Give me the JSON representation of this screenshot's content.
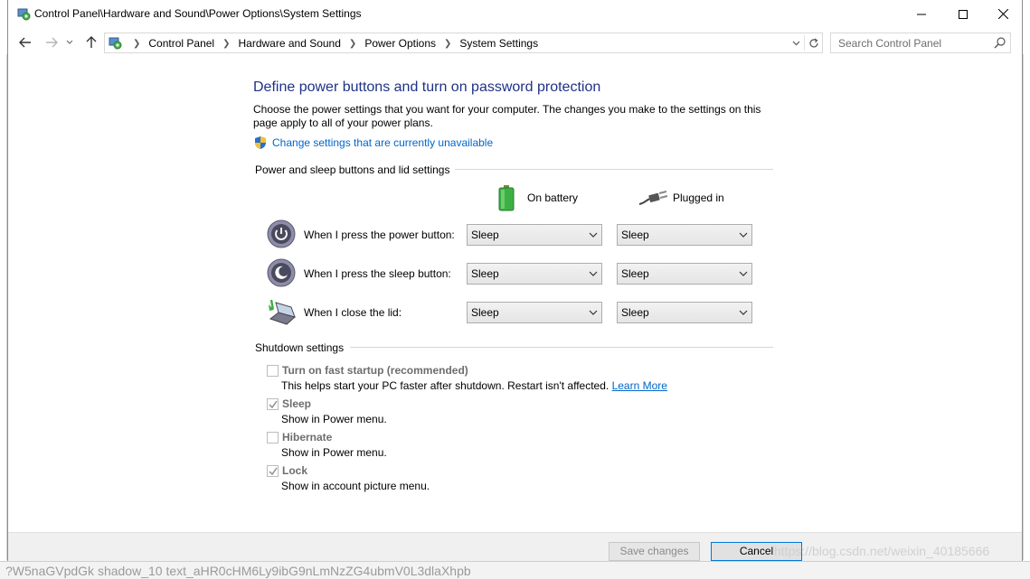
{
  "window": {
    "title": "Control Panel\\Hardware and Sound\\Power Options\\System Settings"
  },
  "addressbar": {
    "crumbs": [
      "Control Panel",
      "Hardware and Sound",
      "Power Options",
      "System Settings"
    ]
  },
  "search": {
    "placeholder": "Search Control Panel"
  },
  "page": {
    "heading": "Define power buttons and turn on password protection",
    "description": "Choose the power settings that you want for your computer. The changes you make to the settings on this page apply to all of your power plans.",
    "change_link": "Change settings that are currently unavailable"
  },
  "power_buttons": {
    "section_title": "Power and sleep buttons and lid settings",
    "col_battery": "On battery",
    "col_plugged": "Plugged in",
    "rows": [
      {
        "label": "When I press the power button:",
        "battery": "Sleep",
        "plugged": "Sleep"
      },
      {
        "label": "When I press the sleep button:",
        "battery": "Sleep",
        "plugged": "Sleep"
      },
      {
        "label": "When I close the lid:",
        "battery": "Sleep",
        "plugged": "Sleep"
      }
    ]
  },
  "shutdown": {
    "section_title": "Shutdown settings",
    "items": [
      {
        "label": "Turn on fast startup (recommended)",
        "checked": false,
        "desc": "This helps start your PC faster after shutdown. Restart isn't affected.",
        "link": "Learn More"
      },
      {
        "label": "Sleep",
        "checked": true,
        "desc": "Show in Power menu."
      },
      {
        "label": "Hibernate",
        "checked": false,
        "desc": "Show in Power menu."
      },
      {
        "label": "Lock",
        "checked": true,
        "desc": "Show in account picture menu."
      }
    ]
  },
  "footer": {
    "save_label": "Save changes",
    "cancel_label": "Cancel"
  },
  "background": {
    "watermark": "https://blog.csdn.net/weixin_40185666",
    "bottom_text": "?W5naGVpdGk shadow_10 text_aHR0cHM6Ly9ibG9nLmNzZG4ubmV0L3dlaXhpb"
  }
}
